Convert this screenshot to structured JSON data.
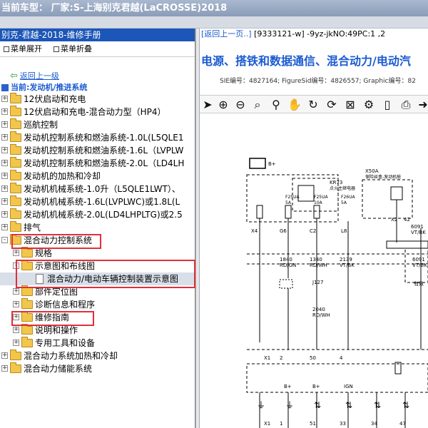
{
  "window": {
    "title": "当前车型：  厂家:S-上海别克君越(LaCROSSE)2018"
  },
  "left_panel": {
    "header": "别克-君越-2018-维修手册",
    "expand_all": "菜单展开",
    "collapse_all": "菜单折叠",
    "back_link": "返回上一级",
    "current_label": "当前:发动机/推进系统"
  },
  "tree": [
    {
      "label": "12伏启动和充电"
    },
    {
      "label": "12伏启动和充电-混合动力型（HP4）"
    },
    {
      "label": "巡航控制"
    },
    {
      "label": "发动机控制系统和燃油系统-1.0L(L5QLE1"
    },
    {
      "label": "发动机控制系统和燃油系统-1.6L（LVPLW"
    },
    {
      "label": "发动机控制系统和燃油系统-2.0L（LD4LH"
    },
    {
      "label": "发动机的加热和冷却"
    },
    {
      "label": "发动机机械系统-1.0升（L5QLE1LWT）、"
    },
    {
      "label": "发动机机械系统-1.6L(LVPLWC)或1.8L(L"
    },
    {
      "label": "发动机机械系统-2.0L(LD4LHPLTG)或2.5"
    },
    {
      "label": "排气"
    },
    {
      "label": "混合动力控制系统"
    },
    {
      "label": "规格"
    },
    {
      "label": "示意图和布线图"
    },
    {
      "label": "混合动力/电动车辆控制装置示意图"
    },
    {
      "label": "部件定位图"
    },
    {
      "label": "诊断信息和程序"
    },
    {
      "label": "维修指南"
    },
    {
      "label": "说明和操作"
    },
    {
      "label": "专用工具和设备"
    },
    {
      "label": "混合动力系统加热和冷却"
    },
    {
      "label": "混合动力储能系统"
    }
  ],
  "right_panel": {
    "nav_back": "[返回上一页..]",
    "doc_ref": "[9333121-w] -9yz-jkNO:49PC:1 ,2",
    "title": "电源、搭铁和数据通信、混合动力/电动汽",
    "sie_line": "SIE编号：4827164;  FigureSid编号：4826557;  Graphic编号：82"
  },
  "toolbar_icons": [
    "cursor-icon",
    "zoom-in-icon",
    "zoom-out-icon",
    "search-icon",
    "magnifier-icon",
    "hand-icon",
    "rotate-icon",
    "rotate-reset-icon",
    "fit-icon",
    "settings-icon",
    "page-icon",
    "print-icon",
    "next-icon"
  ],
  "diagram_labels": {
    "bplus1": "B+",
    "x50a": "X50A",
    "x50a_sub": "保险丝盒-发动机舱",
    "kr73": "KR73",
    "kr73_sub": "点火主继电器",
    "f25ua": "F25UA",
    "f25ua_amp": "5A",
    "f25ua_2": "F25UA",
    "f25ua_2_amp": "10A",
    "f26ua": "F26UA",
    "f26ua_amp": "5A",
    "x2_label": "X2",
    "x2_pin": "42",
    "x4": "X4",
    "g6": "G6",
    "c2": "C2",
    "l8": "L8",
    "w6091": "6091",
    "vtbk": "VT/BK",
    "w1840": "1840",
    "rdgn": "RD/GN",
    "w2139": "2139",
    "vtbk2": "VT/BK",
    "w1340": "1340",
    "rdwh": "RD/WH",
    "j127": "J127",
    "w2040": "2040",
    "rdwh2": "RD/WH",
    "w6091b": "6091",
    "vtbk3": "VT/BK",
    "youxiao": "有效",
    "x1_a": "X1",
    "pin2": "2",
    "pin50": "50",
    "pin4": "4",
    "bplus2": "B+",
    "bplus3": "B+",
    "ign": "IGN",
    "x1_b": "X1",
    "pin1": "1",
    "pin51": "51",
    "pin33": "33",
    "pin34": "34",
    "pin47": "47"
  }
}
